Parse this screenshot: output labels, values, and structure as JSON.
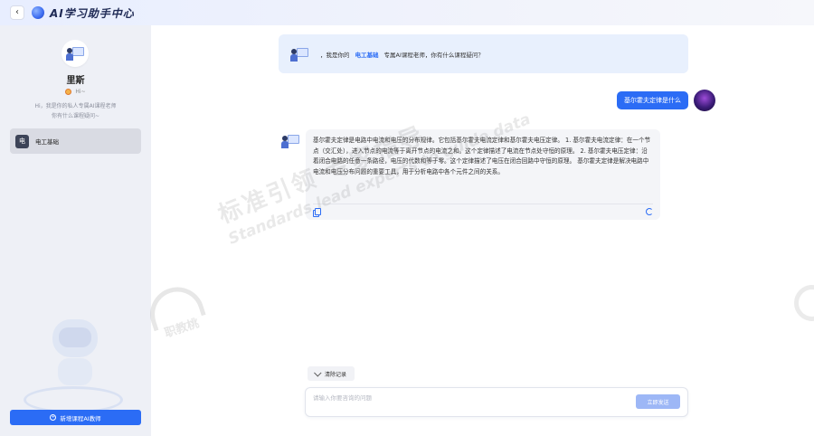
{
  "header": {
    "title": "AI学习助手中心"
  },
  "sidebar": {
    "teacher_name": "里斯",
    "status_text": "Hi~",
    "description_line1": "Hi，我是你的私人专属AI课程老师",
    "description_line2": "你有什么课程疑问~",
    "courses": [
      {
        "badge": "电",
        "label": "电工基础"
      }
    ],
    "new_button_label": "新增课程AI教师"
  },
  "chat": {
    "welcome_prefix": "，我是你的",
    "welcome_course": "电工基础",
    "welcome_suffix": "专属AI课程老师，你有什么课程疑问？",
    "user_message": "基尔霍夫定律是什么",
    "ai_message": "基尔霍夫定律是电路中电流和电压的分布规律。它包括基尔霍夫电流定律和基尔霍夫电压定律。 1. 基尔霍夫电流定律：在一个节点（交汇处），进入节点的电流等于离开节点的电流之和。这个定律描述了电流在节点处守恒的原理。 2. 基尔霍夫电压定律：沿着闭合电路的任意一条路径，电压的代数和等于零。这个定律描述了电压在闭合回路中守恒的原理。 基尔霍夫定律是解决电路中电流和电压分布问题的重要工具，用于分析电路中各个元件之间的关系。"
  },
  "input": {
    "clear_label": "清除记录",
    "placeholder": "请输入你要咨询的问题",
    "value": "",
    "send_label": "立即发送"
  },
  "watermark": {
    "cn": "标准引领 专家指导",
    "en": "Standards lead experts to guide data",
    "logo_text": "职教桃"
  },
  "colors": {
    "accent": "#2b6cf5",
    "send_disabled": "#9db7f6",
    "welcome_bg": "#e8f0fd",
    "sidebar_bg": "#eef0f6"
  }
}
